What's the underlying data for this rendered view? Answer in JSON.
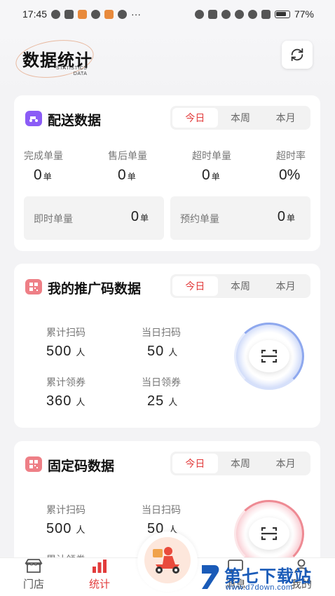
{
  "status_bar": {
    "time": "17:45",
    "dots": "···",
    "battery": "77%"
  },
  "header": {
    "logo_title": "数据统计",
    "logo_sub_1": "STATISTICS",
    "logo_sub_2": "DATA"
  },
  "segment": {
    "today": "今日",
    "week": "本周",
    "month": "本月"
  },
  "delivery": {
    "title": "配送数据",
    "stats": [
      {
        "label": "完成单量",
        "value": "0",
        "unit": "单"
      },
      {
        "label": "售后单量",
        "value": "0",
        "unit": "单"
      },
      {
        "label": "超时单量",
        "value": "0",
        "unit": "单"
      },
      {
        "label": "超时率",
        "value": "0%",
        "unit": ""
      }
    ],
    "instant_label": "即时单量",
    "instant_value": "0",
    "instant_unit": "单",
    "reserve_label": "预约单量",
    "reserve_value": "0",
    "reserve_unit": "单"
  },
  "promo": {
    "title": "我的推广码数据",
    "total_scan_label": "累计扫码",
    "total_scan_value": "500",
    "total_scan_unit": "人",
    "day_scan_label": "当日扫码",
    "day_scan_value": "50",
    "day_scan_unit": "人",
    "total_coupon_label": "累计领券",
    "total_coupon_value": "360",
    "total_coupon_unit": "人",
    "day_coupon_label": "当日领券",
    "day_coupon_value": "25",
    "day_coupon_unit": "人"
  },
  "fixed": {
    "title": "固定码数据",
    "total_scan_label": "累计扫码",
    "total_scan_value": "500",
    "total_scan_unit": "人",
    "day_scan_label": "当日扫码",
    "day_scan_value": "50",
    "day_scan_unit": "人",
    "total_coupon_label": "累计领券"
  },
  "tabbar": {
    "store": "门店",
    "stats": "统计",
    "deliver": "配送",
    "messages": "消息",
    "mine": "我的"
  },
  "watermark": {
    "title": "第七下载站",
    "url": "www.d7down.com"
  },
  "colors": {
    "accent": "#e23c3c",
    "blue_ring": "#6b8fe8",
    "red_ring": "#e8707a"
  }
}
